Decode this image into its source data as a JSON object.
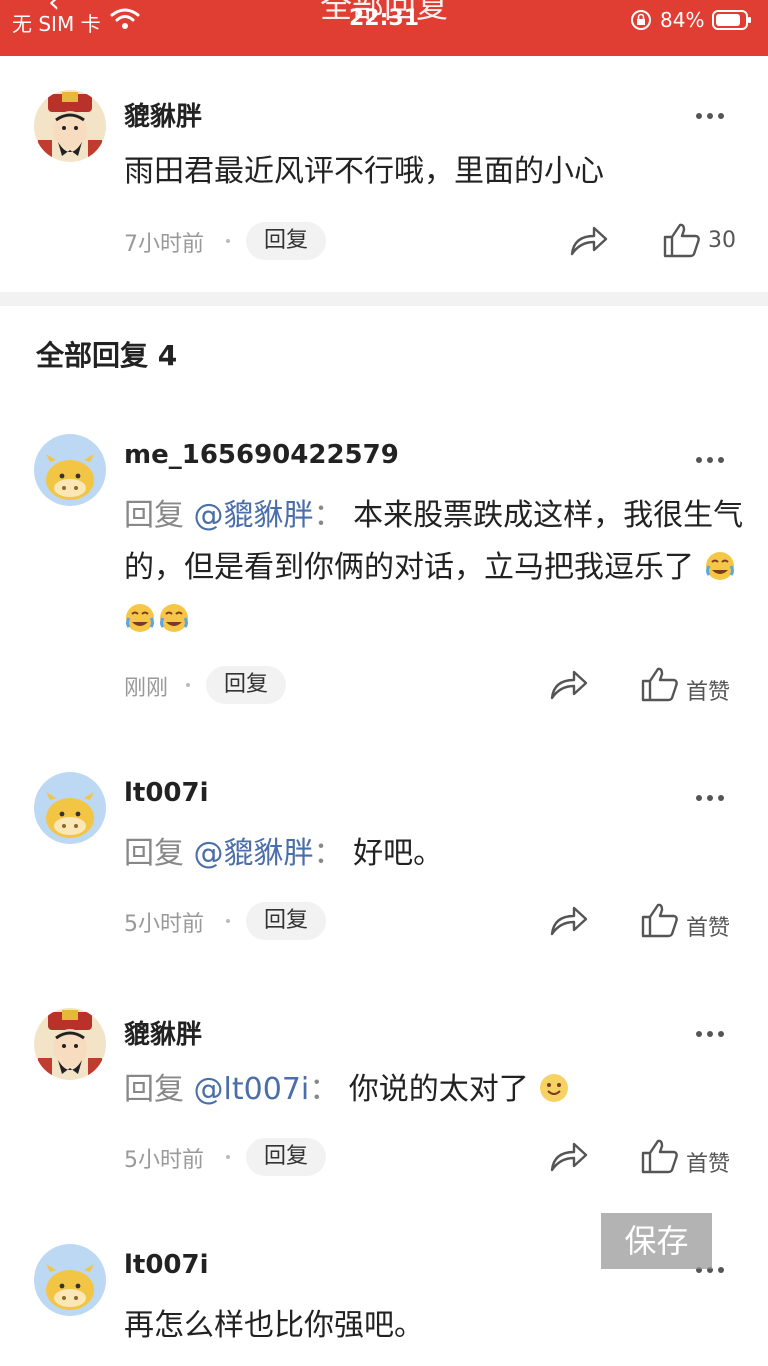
{
  "status_bar": {
    "carrier": "无 SIM 卡",
    "time": "22:31",
    "battery": "84%",
    "page_title": "全部回复",
    "back_glyph": "‹"
  },
  "main_comment": {
    "username": "貔貅胖",
    "text": "雨田君最近风评不行哦，里面的小心",
    "time": "7小时前",
    "reply_label": "回复",
    "like_count": "30"
  },
  "replies_header": "全部回复 4",
  "replies": [
    {
      "username": "me_165690422579",
      "reply_prefix": "回复",
      "mention": "@貔貅胖",
      "separator": "：",
      "text": "本来股票跌成这样，我很生气的，但是看到你俩的对话，立马把我逗乐了",
      "emojis": [
        "crying-laughing-emoji",
        "crying-laughing-emoji",
        "crying-laughing-emoji"
      ],
      "time": "刚刚",
      "reply_label": "回复",
      "like_label": "首赞"
    },
    {
      "username": "lt007i",
      "reply_prefix": "回复",
      "mention": "@貔貅胖",
      "separator": "：",
      "text": "好吧。",
      "time": "5小时前",
      "reply_label": "回复",
      "like_label": "首赞"
    },
    {
      "username": "貔貅胖",
      "reply_prefix": "回复",
      "mention": "@lt007i",
      "separator": "：",
      "text": "你说的太对了",
      "emojis": [
        "smile-emoji"
      ],
      "time": "5小时前",
      "reply_label": "回复",
      "like_label": "首赞"
    },
    {
      "username": "lt007i",
      "text": "再怎么样也比你强吧。"
    }
  ],
  "save_button": "保存",
  "colors": {
    "header_red": "#e03d33",
    "mention_blue": "#4a6ea9",
    "muted_gray": "#999999"
  }
}
